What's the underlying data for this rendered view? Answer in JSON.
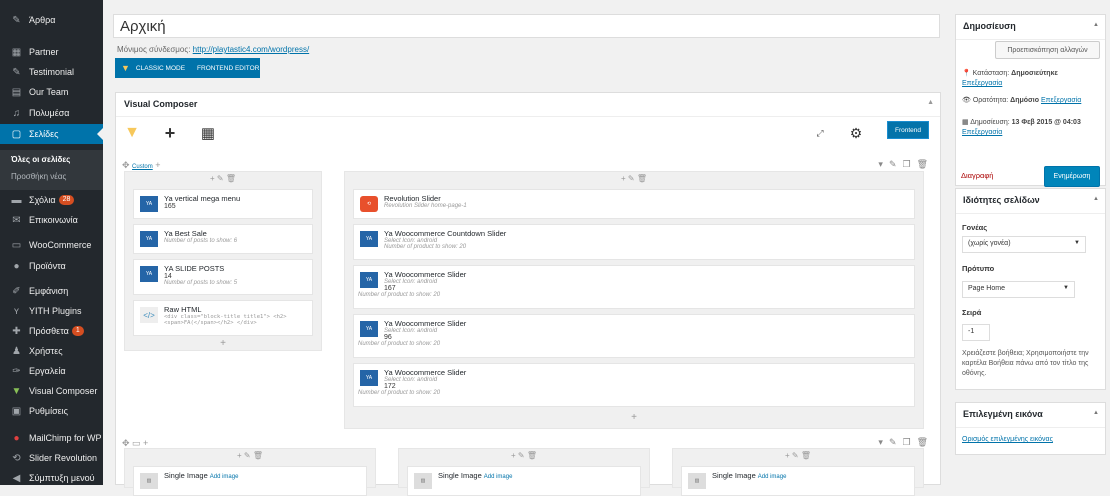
{
  "sidebar": {
    "items": [
      {
        "icon": "pin-icon",
        "label": "Άρθρα"
      },
      {
        "icon": "partner-icon",
        "label": "Partner"
      },
      {
        "icon": "testimonial-icon",
        "label": "Testimonial"
      },
      {
        "icon": "team-icon",
        "label": "Our Team"
      },
      {
        "icon": "media-icon",
        "label": "Πολυμέσα"
      },
      {
        "icon": "pages-icon",
        "label": "Σελίδες"
      }
    ],
    "submenu": [
      "Όλες οι σελίδες",
      "Προσθήκη νέας"
    ],
    "items2": [
      {
        "icon": "comments-icon",
        "label": "Σχόλια",
        "badge": "28"
      },
      {
        "icon": "mail-icon",
        "label": "Επικοινωνία"
      },
      {
        "icon": "woo-icon",
        "label": "WooCommerce"
      },
      {
        "icon": "products-icon",
        "label": "Προϊόντα"
      },
      {
        "icon": "appearance-icon",
        "label": "Εμφάνιση"
      },
      {
        "icon": "yith-icon",
        "label": "YITH Plugins"
      },
      {
        "icon": "plugins-icon",
        "label": "Πρόσθετα",
        "badge": "1"
      },
      {
        "icon": "users-icon",
        "label": "Χρήστες"
      },
      {
        "icon": "tools-icon",
        "label": "Εργαλεία"
      },
      {
        "icon": "vc-icon",
        "label": "Visual Composer"
      },
      {
        "icon": "settings-icon",
        "label": "Ρυθμίσεις"
      },
      {
        "icon": "mailchimp-icon",
        "label": "MailChimp for WP"
      },
      {
        "icon": "slider-icon",
        "label": "Slider Revolution"
      },
      {
        "icon": "collapse-icon",
        "label": "Σύμπτυξη μενού"
      }
    ]
  },
  "editor": {
    "title": "Αρχική",
    "permalink_label": "Μόνιμος σύνδεσμος:",
    "permalink_url": "http://playtastic4.com/wordpress/",
    "mode_classic": "CLASSIC MODE",
    "mode_frontend": "FRONTEND EDITOR"
  },
  "vc": {
    "title": "Visual Composer",
    "frontend_btn": "Frontend",
    "row1_tag": "Custom",
    "left_col": [
      {
        "title": "Ya vertical mega menu",
        "sub": "",
        "num": "165"
      },
      {
        "title": "Ya Best Sale",
        "sub": "Number of posts to show: 6",
        "num": ""
      },
      {
        "title": "YA SLIDE POSTS",
        "sub": "Number of posts to show: 5",
        "num": "14"
      },
      {
        "title": "Raw HTML",
        "sub": "<div class=\"block-title title1\"> <h2><span>FA(</span></h2> </div>",
        "num": ""
      }
    ],
    "right_col": [
      {
        "title": "Revolution Slider",
        "sub": "Revolution Slider home-page-1",
        "num": "",
        "extra": ""
      },
      {
        "title": "Ya Woocommerce Countdown Slider",
        "sub": "Select Icon: android",
        "num": "",
        "extra": "Number of product to show: 20"
      },
      {
        "title": "Ya Woocommerce Slider",
        "sub": "Select Icon: android",
        "num": "167",
        "extra": "Number of product to show: 20"
      },
      {
        "title": "Ya Woocommerce Slider",
        "sub": "Select Icon: android",
        "num": "96",
        "extra": "Number of product to show: 20"
      },
      {
        "title": "Ya Woocommerce Slider",
        "sub": "Select Icon: android",
        "num": "172",
        "extra": "Number of product to show: 20"
      }
    ],
    "row2": [
      {
        "title": "Single Image",
        "link": "Add image"
      },
      {
        "title": "Single Image",
        "link": "Add image"
      },
      {
        "title": "Single Image",
        "link": "Add image"
      }
    ]
  },
  "publish": {
    "title": "Δημοσίευση",
    "preview": "Προεπισκόπηση αλλαγών",
    "status_label": "Κατάσταση:",
    "status_value": "Δημοσιεύτηκε",
    "edit": "Επεξεργασία",
    "visibility_label": "Ορατότητα:",
    "visibility_value": "Δημόσιο",
    "date_label": "Δημοσίευση:",
    "date_value": "13 Φεβ 2015 @ 04:03",
    "delete": "Διαγραφή",
    "update": "Ενημέρωση"
  },
  "attributes": {
    "title": "Ιδιότητες σελίδων",
    "parent_label": "Γονέας",
    "parent_value": "(χωρίς γονέα)",
    "template_label": "Πρότυπο",
    "template_value": "Page Home",
    "order_label": "Σειρά",
    "order_value": "-1",
    "help": "Χρειάζεστε βοήθεια; Χρησιμοποιήστε την καρτέλα Βοήθεια πάνω από τον τίτλο της οθόνης."
  },
  "featured": {
    "title": "Επιλεγμένη εικόνα",
    "link": "Ορισμός επιλεγμένης εικόνας"
  },
  "colors": {
    "accent": "#0073aa",
    "sidebar": "#23282d",
    "danger": "#a00"
  }
}
